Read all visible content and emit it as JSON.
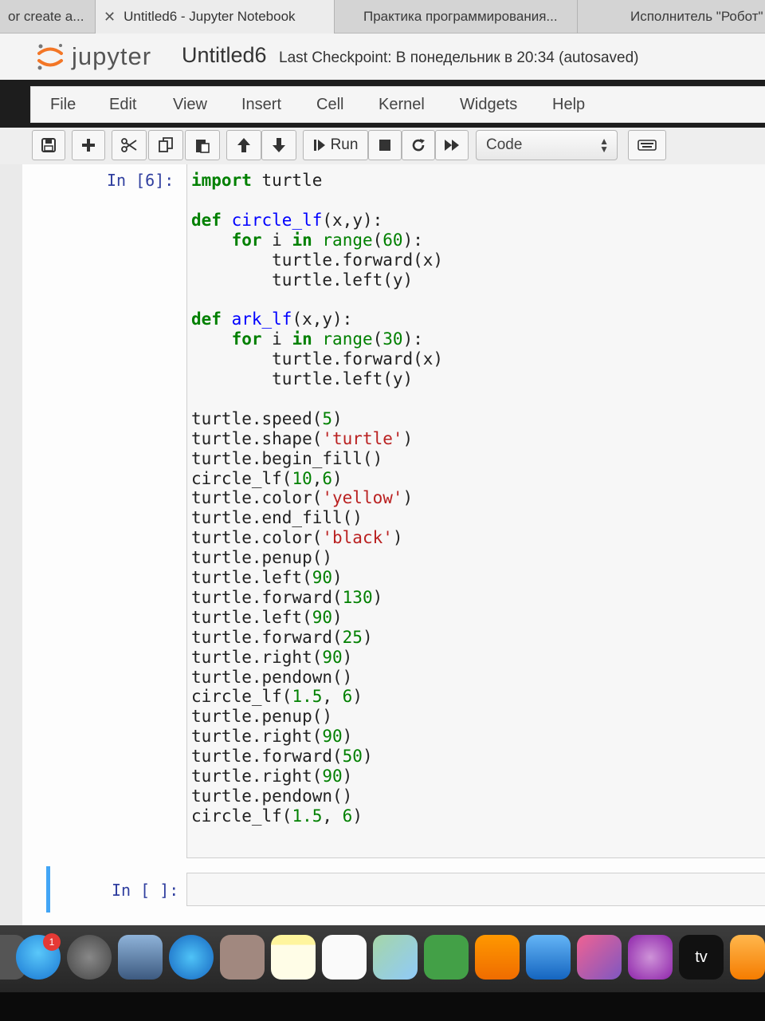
{
  "browser": {
    "tabs": [
      {
        "label": "or create a..."
      },
      {
        "label": "Untitled6 - Jupyter Notebook"
      },
      {
        "label": "Практика программирования..."
      },
      {
        "label": "Исполнитель \"Робот\""
      }
    ]
  },
  "header": {
    "logo_text": "jupyter",
    "notebook_title": "Untitled6",
    "checkpoint": "Last Checkpoint: В понедельник в 20:34  (autosaved)"
  },
  "menu": [
    "File",
    "Edit",
    "View",
    "Insert",
    "Cell",
    "Kernel",
    "Widgets",
    "Help"
  ],
  "toolbar": {
    "run_label": "Run",
    "cell_type": "Code",
    "icons": [
      "save-icon",
      "plus-icon",
      "cut-icon",
      "copy-icon",
      "paste-icon",
      "arrow-up-icon",
      "arrow-down-icon",
      "step-run-icon",
      "stop-icon",
      "restart-icon",
      "fast-forward-icon",
      "keyboard-icon"
    ]
  },
  "cells": [
    {
      "prompt": "In [6]:",
      "lines": [
        "import turtle",
        "",
        "def circle_lf(x,y):",
        "    for i in range(60):",
        "        turtle.forward(x)",
        "        turtle.left(y)",
        "",
        "def ark_lf(x,y):",
        "    for i in range(30):",
        "        turtle.forward(x)",
        "        turtle.left(y)",
        "",
        "turtle.speed(5)",
        "turtle.shape('turtle')",
        "turtle.begin_fill()",
        "circle_lf(10,6)",
        "turtle.color('yellow')",
        "turtle.end_fill()",
        "turtle.color('black')",
        "turtle.penup()",
        "turtle.left(90)",
        "turtle.forward(130)",
        "turtle.left(90)",
        "turtle.forward(25)",
        "turtle.right(90)",
        "turtle.pendown()",
        "circle_lf(1.5, 6)",
        "turtle.penup()",
        "turtle.right(90)",
        "turtle.forward(50)",
        "turtle.right(90)",
        "turtle.pendown()",
        "circle_lf(1.5, 6)"
      ]
    },
    {
      "prompt": "In [ ]:",
      "lines": []
    }
  ],
  "dock": {
    "messages_badge": "1",
    "icons": [
      "messages-icon",
      "launchpad-icon",
      "photo-icon",
      "safari-icon",
      "contacts-icon",
      "notes-icon",
      "reminders-icon",
      "maps-icon",
      "facetime-icon",
      "pages-icon",
      "keynote-icon",
      "music-icon",
      "podcasts-icon",
      "apple-tv-icon",
      "books-icon"
    ],
    "tv_label": "tv"
  }
}
